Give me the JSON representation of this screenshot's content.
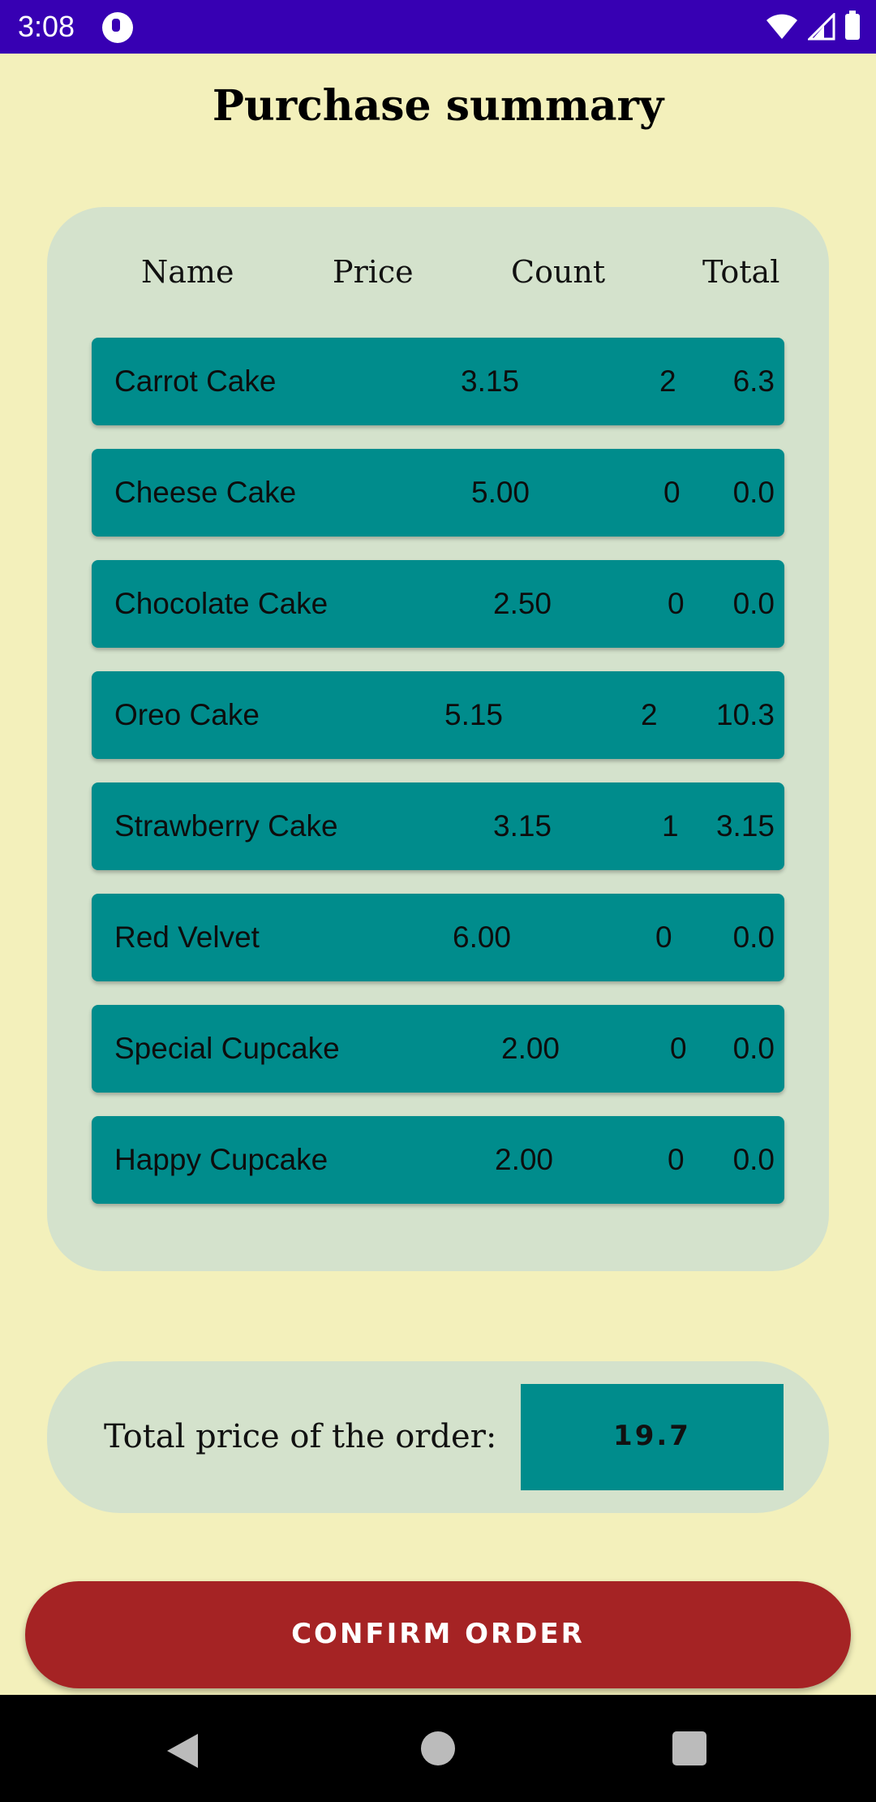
{
  "status_bar": {
    "time": "3:08"
  },
  "title": "Purchase summary",
  "table": {
    "headers": [
      "Name",
      "Price",
      "Count",
      "Total"
    ],
    "rows": [
      {
        "name": "Carrot Cake",
        "price": "3.15",
        "count": "2",
        "total": "6.3"
      },
      {
        "name": "Cheese Cake",
        "price": "5.00",
        "count": "0",
        "total": "0.0"
      },
      {
        "name": "Chocolate Cake",
        "price": "2.50",
        "count": "0",
        "total": "0.0"
      },
      {
        "name": "Oreo Cake",
        "price": "5.15",
        "count": "2",
        "total": "10.3"
      },
      {
        "name": "Strawberry Cake",
        "price": "3.15",
        "count": "1",
        "total": "3.15"
      },
      {
        "name": "Red Velvet",
        "price": "6.00",
        "count": "0",
        "total": "0.0"
      },
      {
        "name": "Special Cupcake",
        "price": "2.00",
        "count": "0",
        "total": "0.0"
      },
      {
        "name": "Happy Cupcake",
        "price": "2.00",
        "count": "0",
        "total": "0.0"
      }
    ]
  },
  "summary": {
    "label": "Total price of the order:",
    "value": "19.7"
  },
  "confirm_button": {
    "label": "CONFIRM ORDER"
  },
  "colors": {
    "status_bar": "#3700b3",
    "background": "#f3f0bb",
    "card": "#d4e2cc",
    "row": "#008c8c",
    "button": "#a52324"
  }
}
